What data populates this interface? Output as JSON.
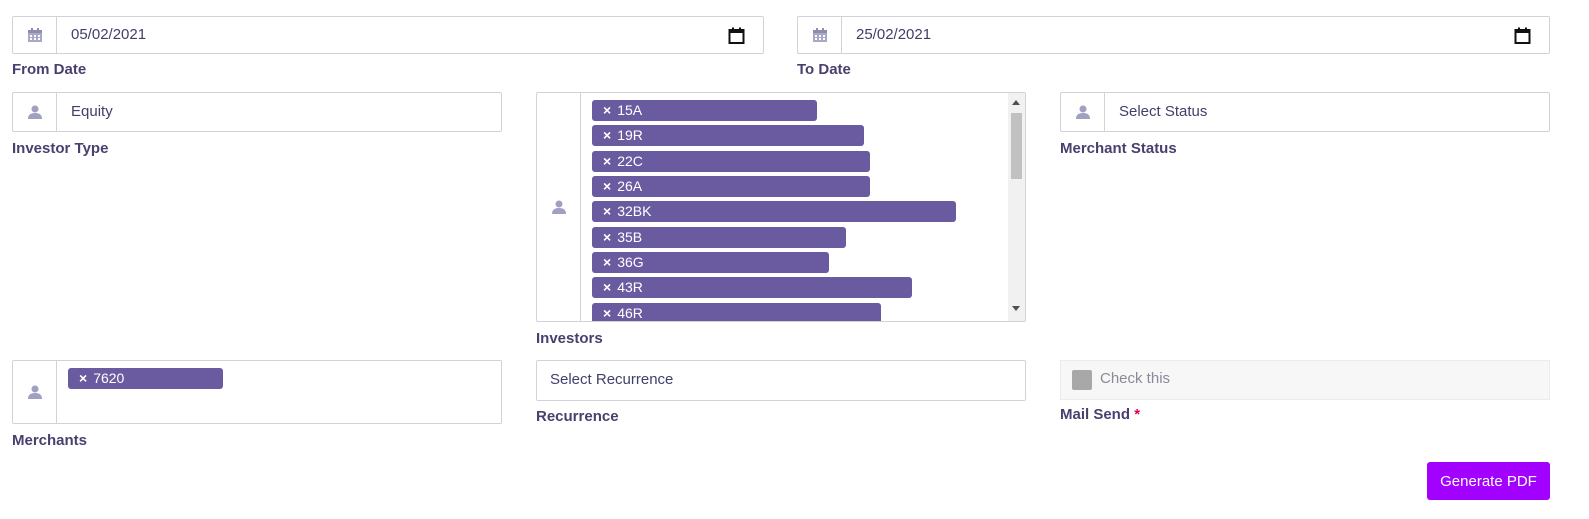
{
  "from_date": {
    "value": "05/02/2021",
    "label": "From Date"
  },
  "to_date": {
    "value": "25/02/2021",
    "label": "To Date"
  },
  "investor_type": {
    "value": "Equity",
    "label": "Investor Type"
  },
  "investors": {
    "label": "Investors",
    "tags": [
      "15A",
      "19R",
      "22C",
      "26A",
      "32BK",
      "35B",
      "36G",
      "43R",
      "46R"
    ],
    "remove_symbol": "×"
  },
  "merchant_status": {
    "placeholder": "Select Status",
    "label": "Merchant Status"
  },
  "merchants": {
    "label": "Merchants",
    "tags": [
      "7620"
    ]
  },
  "recurrence": {
    "placeholder": "Select Recurrence",
    "label": "Recurrence"
  },
  "mail_send": {
    "checkbox_text": "Check this",
    "label": "Mail Send",
    "required_mark": "*"
  },
  "generate_pdf": {
    "label": "Generate PDF"
  },
  "colors": {
    "accent": "#a200ff",
    "tag": "#6a5ba0",
    "label": "#4a3f6e",
    "required": "#e0004a"
  }
}
